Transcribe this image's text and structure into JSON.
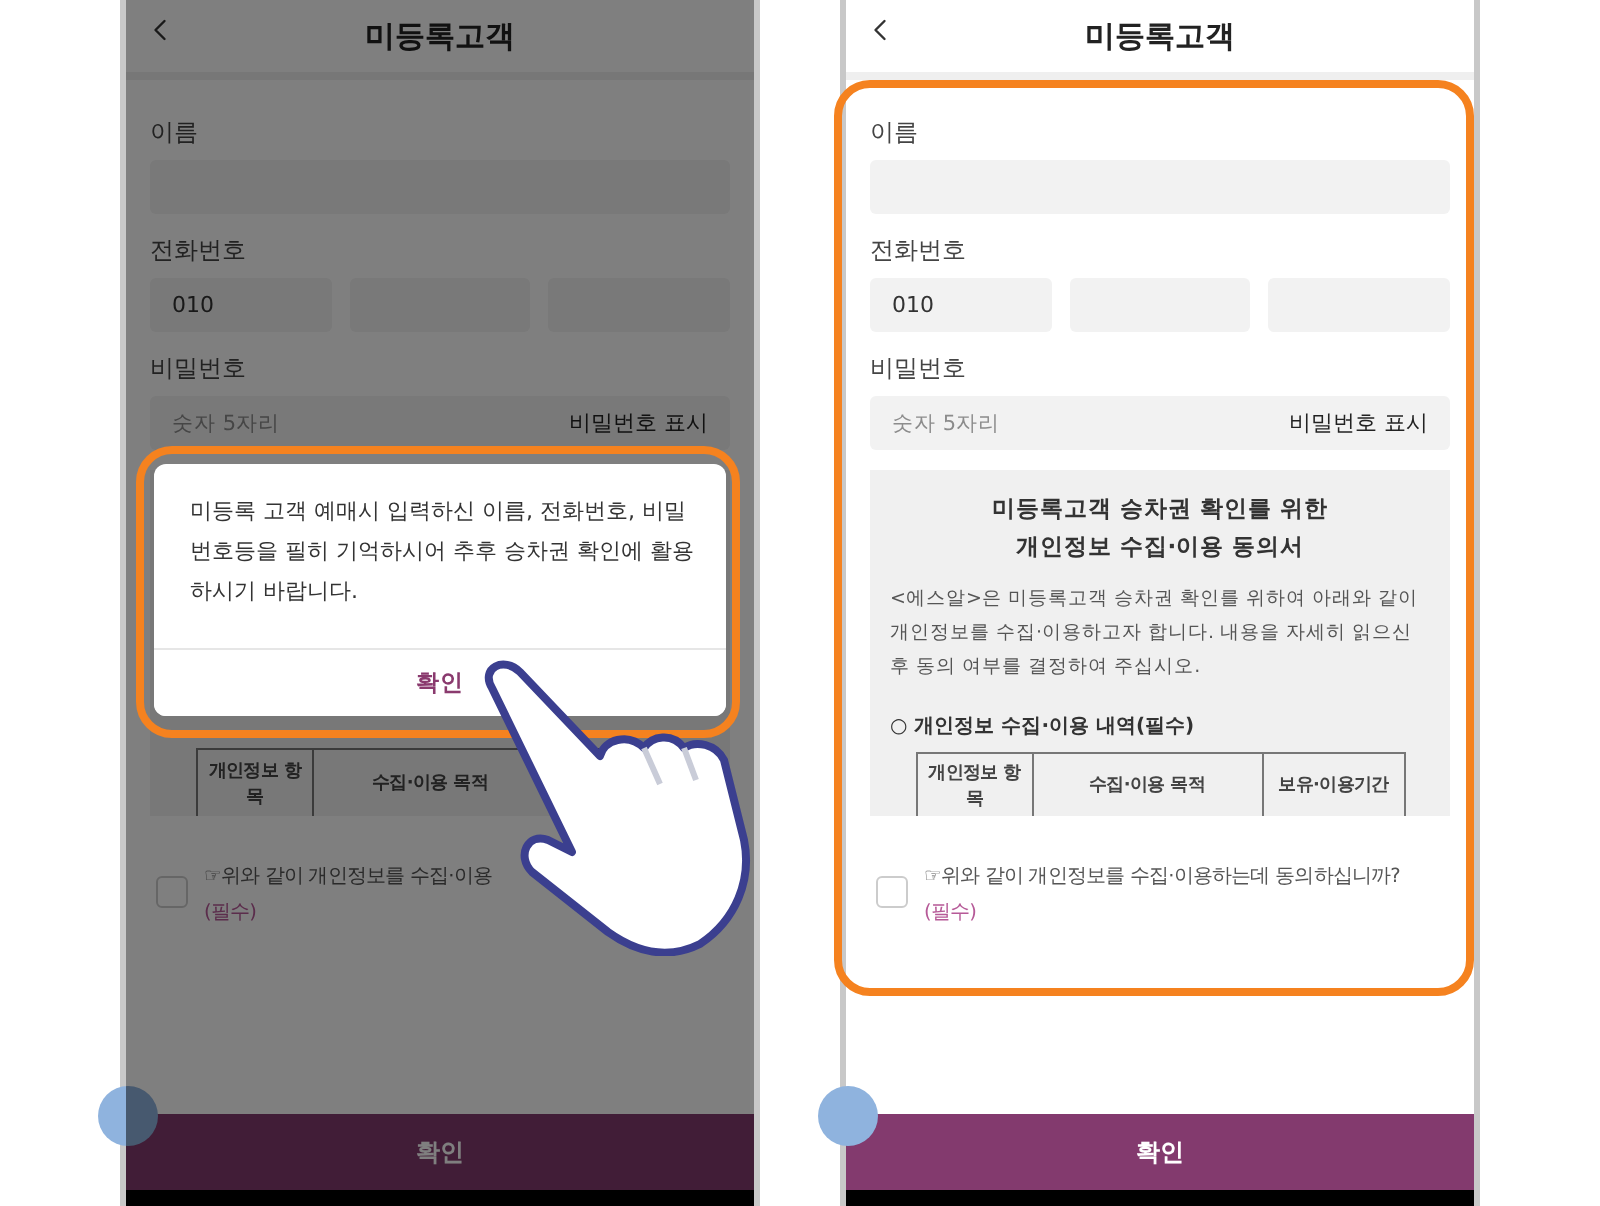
{
  "screens": [
    {
      "dimmed": true,
      "form_highlighted": false,
      "pointer": true,
      "title": "미등록고객",
      "name_label": "이름",
      "phone_label": "전화번호",
      "phone_prefix": "010",
      "password_label": "비밀번호",
      "password_placeholder": "숫자 5자리",
      "show_password": "비밀번호 표시",
      "consent": {
        "columns": [
          "개인정보 항목",
          "수집·이용 목적"
        ]
      },
      "agree": {
        "checked": false,
        "label": "☞위와 같이 개인정보를 수집·이용",
        "required": "(필수)"
      },
      "submit": "확인",
      "dialog": {
        "highlighted": true,
        "message": "미등록 고객 예매시 입력하신 이름, 전화번호, 비밀번호등을 필히 기억하시어 추후 승차권 확인에 활용하시기 바랍니다.",
        "button": "확인"
      }
    },
    {
      "dimmed": false,
      "form_highlighted": true,
      "pointer": false,
      "title": "미등록고객",
      "name_label": "이름",
      "phone_label": "전화번호",
      "phone_prefix": "010",
      "password_label": "비밀번호",
      "password_placeholder": "숫자 5자리",
      "show_password": "비밀번호 표시",
      "consent": {
        "title_lines": [
          "미등록고객 승차권 확인를 위한",
          "개인정보 수집·이용 동의서"
        ],
        "paragraph": "<에스알>은 미등록고객 승차권 확인를 위하여 아래와 같이 개인정보를 수집·이용하고자 합니다. 내용을 자세히 읽으신 후 동의 여부를 결정하여 주십시오.",
        "section": "○ 개인정보 수집·이용 내역(필수)",
        "columns": [
          "개인정보 항목",
          "수집·이용 목적",
          "보유·이용기간"
        ]
      },
      "agree": {
        "checked": false,
        "label": "☞위와 같이 개인정보를 수집·이용하는데 동의하십니까?",
        "required": "(필수)"
      },
      "submit": "확인"
    }
  ]
}
